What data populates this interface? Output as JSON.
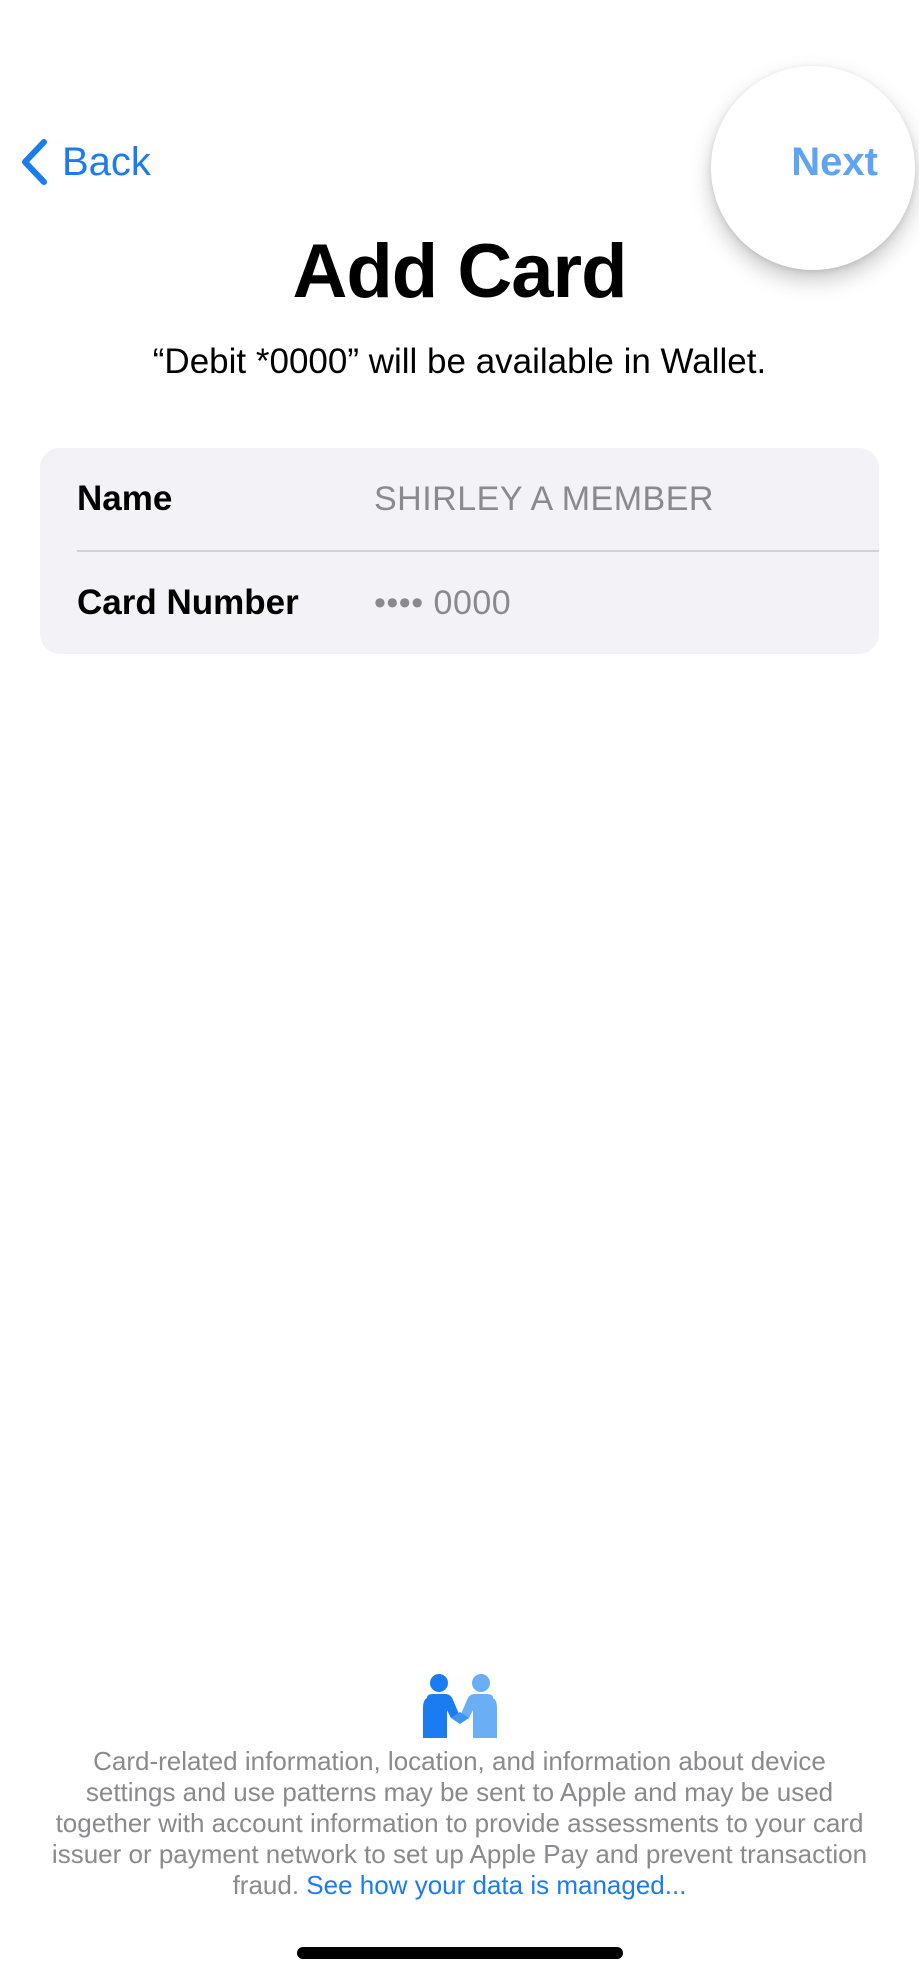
{
  "nav": {
    "back_label": "Back",
    "next_label": "Next"
  },
  "header": {
    "title": "Add Card",
    "subtitle": "“Debit *0000” will be available in Wallet."
  },
  "card_info": {
    "rows": [
      {
        "label": "Name",
        "value": "SHIRLEY A MEMBER"
      },
      {
        "label": "Card Number",
        "value": "•••• 0000"
      }
    ]
  },
  "privacy": {
    "icon": "handshake-privacy-icon",
    "text": "Card-related information, location, and information about device settings and use patterns may be sent to Apple and may be used together with account information to provide assessments to your card issuer or payment network to set up Apple Pay and prevent transaction fraud. ",
    "link": "See how your data is managed..."
  },
  "colors": {
    "accent": "#1a7cf0",
    "next_highlight": "#5ea4f3",
    "group_background": "#f2f2f7",
    "secondary_text": "#8a8a8e"
  }
}
